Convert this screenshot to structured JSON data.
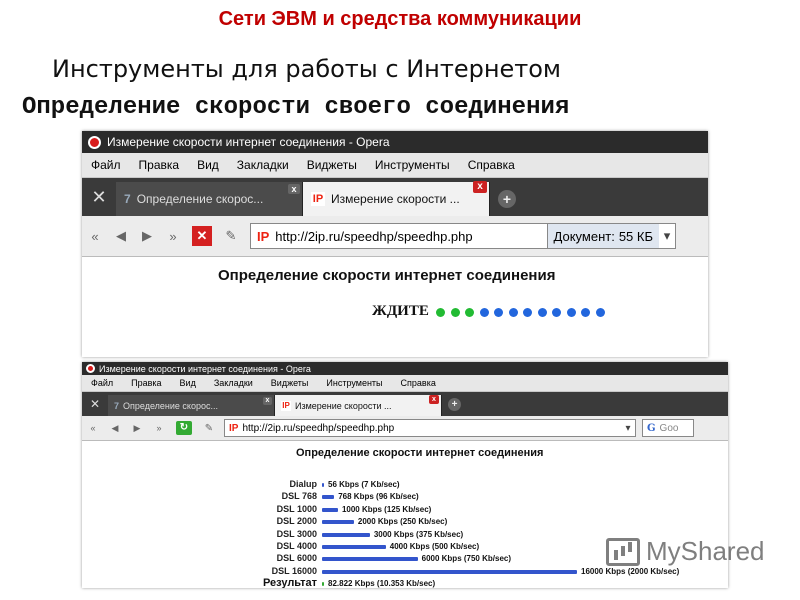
{
  "slide": {
    "header": "Сети ЭВМ и средства коммуникации",
    "subtitle": "Инструменты для работы с Интернетом",
    "heading": "Определение скорости своего соединения"
  },
  "browser1": {
    "window_title": "Измерение скорости интернет соединения - Opera",
    "menu": [
      "Файл",
      "Правка",
      "Вид",
      "Закладки",
      "Виджеты",
      "Инструменты",
      "Справка"
    ],
    "tabs": [
      {
        "label": "Определение скорос..."
      },
      {
        "label": "Измерение скорости ..."
      }
    ],
    "address": "http://2ip.ru/speedhp/speedhp.php",
    "document_label": "Документ:",
    "document_size": "55 КБ",
    "page_title": "Определение скорости интернет соединения",
    "wait_label": "ЖДИТЕ",
    "dots_green": 3,
    "dots_blue": 9,
    "colors": {
      "green": "#22bb33",
      "blue": "#2266dd"
    }
  },
  "browser2": {
    "window_title": "Измерение скорости интернет соединения - Opera",
    "menu": [
      "Файл",
      "Правка",
      "Вид",
      "Закладки",
      "Виджеты",
      "Инструменты",
      "Справка"
    ],
    "tabs": [
      {
        "label": "Определение скорос..."
      },
      {
        "label": "Измерение скорости ..."
      }
    ],
    "address": "http://2ip.ru/speedhp/speedhp.php",
    "search_placeholder": "Goo",
    "page_title": "Определение скорости интернет соединения",
    "result_label": "Результат"
  },
  "chart_data": {
    "type": "bar",
    "orientation": "horizontal",
    "categories": [
      "Dialup",
      "DSL 768",
      "DSL 1000",
      "DSL 2000",
      "DSL 3000",
      "DSL 4000",
      "DSL 6000",
      "DSL 16000",
      "Результат"
    ],
    "values": [
      56,
      768,
      1000,
      2000,
      3000,
      4000,
      6000,
      16000,
      82.822
    ],
    "value_labels": [
      "56 Kbps (7 Kb/sec)",
      "768 Kbps (96 Kb/sec)",
      "1000 Kbps (125 Kb/sec)",
      "2000 Kbps (250 Kb/sec)",
      "3000 Kbps (375 Kb/sec)",
      "4000 Kbps (500 Kb/sec)",
      "6000 Kbps (750 Kb/sec)",
      "16000 Kbps (2000 Kb/sec)",
      "82.822 Kbps (10.353 Kb/sec)"
    ],
    "unit": "Kbps",
    "xlim": [
      0,
      16000
    ],
    "bar_color": "#3355cc",
    "result_color": "#33aa33"
  },
  "watermark": {
    "text": "MyShared"
  }
}
